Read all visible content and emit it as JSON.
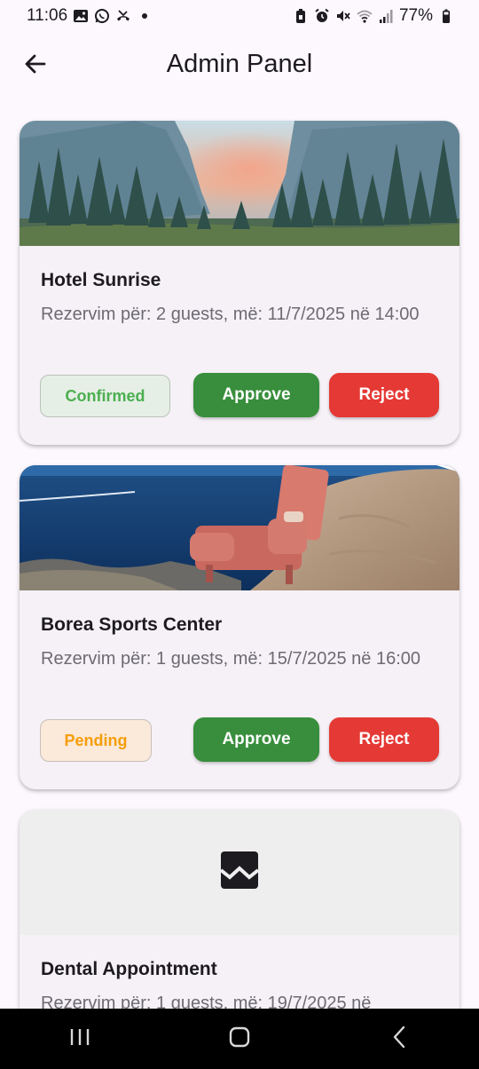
{
  "status_bar": {
    "time": "11:06",
    "battery": "77%"
  },
  "app_bar": {
    "title": "Admin Panel",
    "back_icon": "arrow-back-icon"
  },
  "cards": [
    {
      "title": "Hotel Sunrise",
      "description": "Rezervim për: 2 guests, më: 11/7/2025 në 14:00",
      "status": "Confirmed",
      "approve_label": "Approve",
      "reject_label": "Reject",
      "image": "mountain-lake-forest-image"
    },
    {
      "title": "Borea Sports Center",
      "description": "Rezervim për: 1 guests, më: 15/7/2025 në 16:00",
      "status": "Pending",
      "approve_label": "Approve",
      "reject_label": "Reject",
      "image": "armchair-seaside-cliff-image"
    },
    {
      "title": "Dental Appointment",
      "description": "Rezervim për: 1 guests, më: 19/7/2025 në",
      "image": "broken-image-icon"
    }
  ],
  "colors": {
    "approve": "#388e3c",
    "reject": "#e53935",
    "confirmed_text": "#4caf50",
    "pending_text": "#f59e0b",
    "background": "#fcf8fd",
    "card": "#f5f1f7"
  },
  "nav_bar": {
    "recents_icon": "recents-icon",
    "home_icon": "home-icon",
    "back_icon": "nav-back-icon"
  }
}
